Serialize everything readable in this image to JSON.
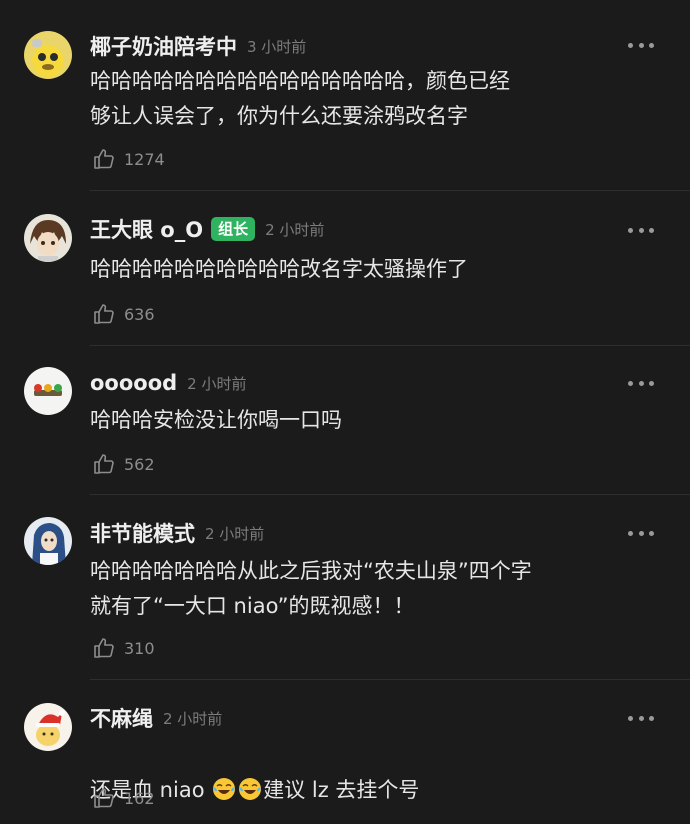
{
  "comments": [
    {
      "name": "椰子奶油陪考中",
      "badge": "",
      "time": "3 小时前",
      "content": "哈哈哈哈哈哈哈哈哈哈哈哈哈哈哈，颜色已经\n够让人误会了，你为什么还要涂鸦改名字",
      "likes": "1274",
      "avatar": "yellow-character-avatar"
    },
    {
      "name": "王大眼 o_O",
      "badge": "组长",
      "time": "2 小时前",
      "content": "哈哈哈哈哈哈哈哈哈哈改名字太骚操作了",
      "likes": "636",
      "avatar": "anime-boy-avatar"
    },
    {
      "name": "oooood",
      "badge": "",
      "time": "2 小时前",
      "content": "哈哈哈安检没让你喝一口吗",
      "likes": "562",
      "avatar": "traffic-lights-avatar"
    },
    {
      "name": "非节能模式",
      "badge": "",
      "time": "2 小时前",
      "content": "哈哈哈哈哈哈哈从此之后我对“农夫山泉”四个字\n就有了“一大口 niao”的既视感！！",
      "likes": "310",
      "avatar": "blue-hair-anime-avatar"
    },
    {
      "name": "不麻绳",
      "badge": "",
      "time": "2 小时前",
      "content_before": "还是血 niao ",
      "content_emoji": [
        "tears-of-joy-emoji",
        "tears-of-joy-emoji"
      ],
      "content_after": "建议 lz 去挂个号",
      "likes": "162",
      "avatar": "santa-hat-avatar"
    }
  ],
  "colors": {
    "background": "#1b1b1b",
    "badge_green": "#2fb361",
    "muted": "#7c7c7c"
  }
}
